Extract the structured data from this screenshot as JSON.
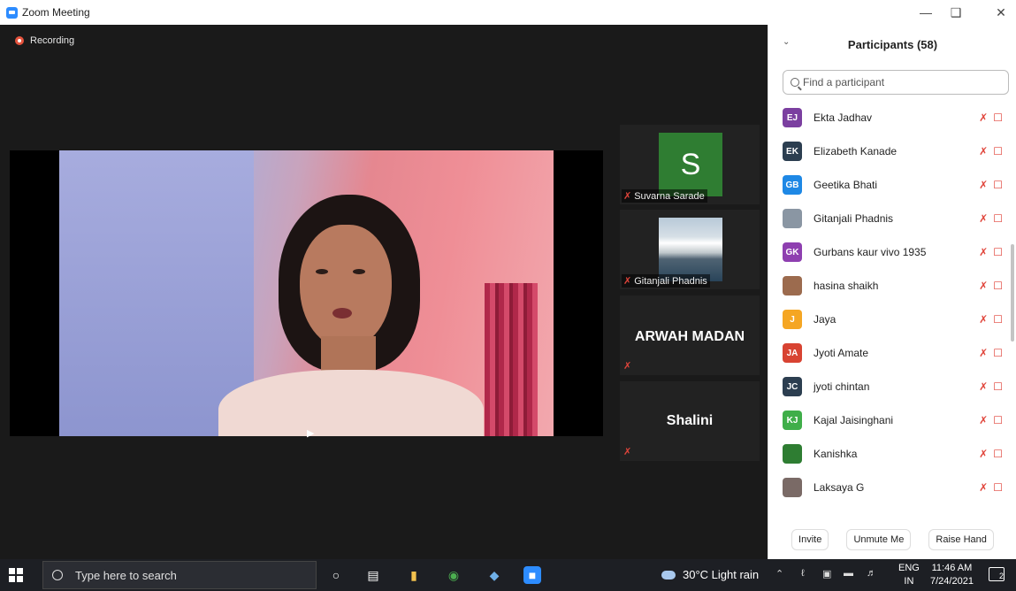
{
  "window": {
    "title": "Zoom Meeting",
    "minimize_icon": "minimize-icon",
    "restore_icon": "restore-icon",
    "close_icon": "close-icon"
  },
  "stage": {
    "recording_label": "Recording",
    "recording_color": "#e5533d",
    "thumbnails": [
      {
        "type": "avatar",
        "initial": "S",
        "avatar_color": "#2f7d32",
        "name": "Suvarna Sarade",
        "muted": true
      },
      {
        "type": "photo",
        "name": "Gitanjali Phadnis",
        "muted": true
      },
      {
        "type": "name",
        "display": "ARWAH MADAN",
        "muted": true
      },
      {
        "type": "name",
        "display": "Shalini",
        "muted": true
      }
    ]
  },
  "panel": {
    "title": "Participants (58)",
    "search_placeholder": "Find a participant",
    "participants": [
      {
        "initials": "EJ",
        "color": "#7b3fa0",
        "name": "Ekta Jadhav"
      },
      {
        "initials": "EK",
        "color": "#2c3e50",
        "name": "Elizabeth Kanade"
      },
      {
        "initials": "GB",
        "color": "#1e88e5",
        "name": "Geetika Bhati"
      },
      {
        "initials": "",
        "color": "#8a96a3",
        "name": "Gitanjali Phadnis"
      },
      {
        "initials": "GK",
        "color": "#8e3fb0",
        "name": "Gurbans kaur  vivo 1935"
      },
      {
        "initials": "",
        "color": "#9c6b4e",
        "name": "hasina shaikh"
      },
      {
        "initials": "J",
        "color": "#f5a623",
        "name": "Jaya"
      },
      {
        "initials": "JA",
        "color": "#d84332",
        "name": "Jyoti Amate"
      },
      {
        "initials": "JC",
        "color": "#2c3e50",
        "name": "jyoti chintan"
      },
      {
        "initials": "KJ",
        "color": "#3fae49",
        "name": "Kajal Jaisinghani"
      },
      {
        "initials": "",
        "color": "#2e7d32",
        "name": "Kanishka"
      },
      {
        "initials": "",
        "color": "#7a6a66",
        "name": "Laksaya G"
      }
    ],
    "footer": {
      "invite": "Invite",
      "unmute": "Unmute Me",
      "raise_hand": "Raise Hand"
    }
  },
  "taskbar": {
    "search_placeholder": "Type here to search",
    "weather": "30°C  Light rain",
    "lang_top": "ENG",
    "lang_bottom": "IN",
    "time": "11:46 AM",
    "date": "7/24/2021",
    "notifications": "2"
  }
}
